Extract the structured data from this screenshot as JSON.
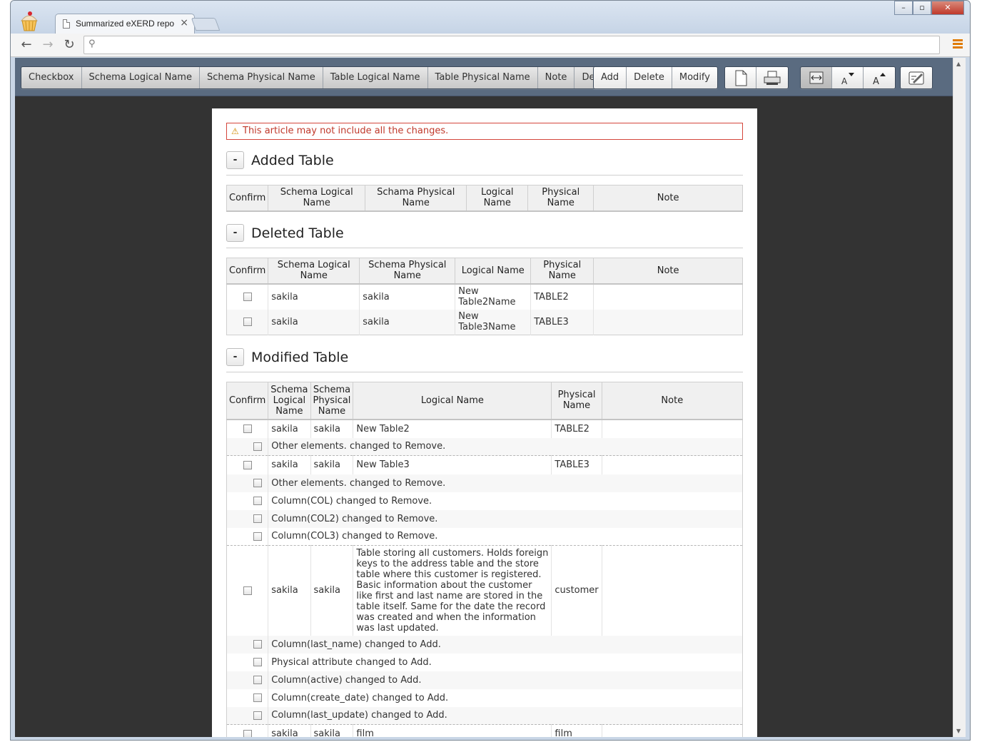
{
  "browser": {
    "tab_title": "Summarized eXERD repo",
    "tab_close": "×",
    "address_value": "",
    "minimize_label": "–",
    "restore_label": "▫",
    "close_label": "✕"
  },
  "toolbar": {
    "view_buttons": [
      "Checkbox",
      "Schema Logical Name",
      "Schema Physical Name",
      "Table Logical Name",
      "Table Physical Name",
      "Note",
      "Details"
    ],
    "filter_buttons": [
      "Add",
      "Delete",
      "Modify"
    ],
    "icons": [
      "new-page-icon",
      "print-icon",
      "fit-width-icon",
      "font-decrease-icon",
      "font-increase-icon",
      "edit-icon"
    ]
  },
  "warning": "This article may not include all the changes.",
  "sections": {
    "added": {
      "toggle": "-",
      "title": "Added Table",
      "headers": [
        "Confirm",
        "Schema Logical Name",
        "Schama Physical Name",
        "Logical Name",
        "Physical Name",
        "Note"
      ]
    },
    "deleted": {
      "toggle": "-",
      "title": "Deleted Table",
      "headers": [
        "Confirm",
        "Schema Logical Name",
        "Schema Physical Name",
        "Logical Name",
        "Physical Name",
        "Note"
      ],
      "rows": [
        {
          "schema_logical": "sakila",
          "schema_physical": "sakila",
          "logical": "New Table2Name",
          "physical": "TABLE2",
          "note": ""
        },
        {
          "schema_logical": "sakila",
          "schema_physical": "sakila",
          "logical": "New Table3Name",
          "physical": "TABLE3",
          "note": ""
        }
      ]
    },
    "modified": {
      "toggle": "-",
      "title": "Modified Table",
      "headers": [
        "Confirm",
        "Schema Logical Name",
        "Schema Physical Name",
        "Logical Name",
        "Physical Name",
        "Note"
      ],
      "tables": [
        {
          "schema_logical": "sakila",
          "schema_physical": "sakila",
          "logical": "New Table2",
          "physical": "TABLE2",
          "note": "",
          "changes": [
            "Other elements. changed to Remove."
          ]
        },
        {
          "schema_logical": "sakila",
          "schema_physical": "sakila",
          "logical": "New Table3",
          "physical": "TABLE3",
          "note": "",
          "changes": [
            "Other elements. changed to Remove.",
            "Column(COL) changed to Remove.",
            "Column(COL2) changed to Remove.",
            "Column(COL3) changed to Remove."
          ]
        },
        {
          "schema_logical": "sakila",
          "schema_physical": "sakila",
          "logical": "Table storing all customers. Holds foreign keys to the address table and the store table where this customer is registered. Basic information about the customer like first and last name are stored in the table itself. Same for the date the record was created and when the information was last updated.",
          "physical": "customer",
          "note": "",
          "changes": [
            "Column(last_name) changed to Add.",
            "Physical attribute changed to Add.",
            "Column(active) changed to Add.",
            "Column(create_date) changed to Add.",
            "Column(last_update) changed to Add."
          ]
        },
        {
          "schema_logical": "sakila",
          "schema_physical": "sakila",
          "logical": "film",
          "physical": "film",
          "note": "",
          "changes": []
        }
      ]
    }
  },
  "colors": {
    "toolbar_bg": "#5a6b80",
    "viewport_bg": "#333333",
    "warning": "#c0392b"
  }
}
